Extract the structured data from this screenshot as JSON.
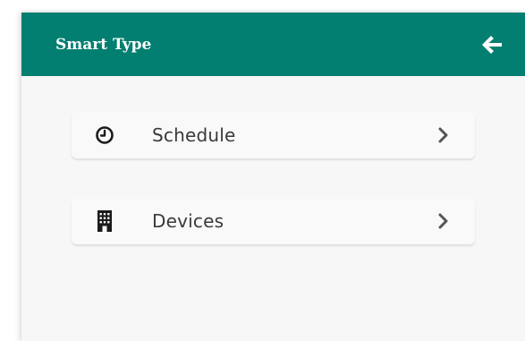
{
  "header": {
    "title": "Smart Type",
    "back_icon": "arrow-left-icon",
    "background": "#027f70"
  },
  "menu": {
    "items": [
      {
        "label": "Schedule",
        "icon": "clock-icon",
        "trailing_icon": "chevron-right-icon"
      },
      {
        "label": "Devices",
        "icon": "building-icon",
        "trailing_icon": "chevron-right-icon"
      }
    ]
  }
}
